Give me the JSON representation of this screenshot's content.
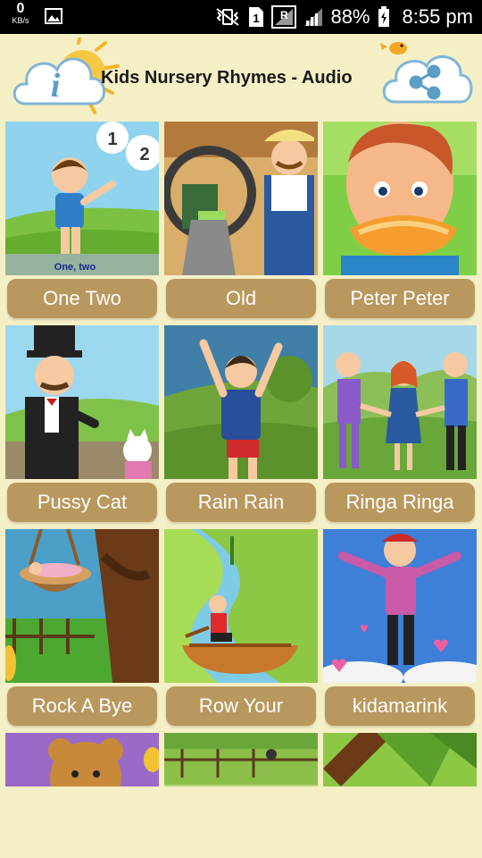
{
  "status_bar": {
    "speed_value": "0",
    "speed_unit": "KB/s",
    "battery_percent": "88%",
    "time": "8:55 pm",
    "icons": [
      "image-icon",
      "vibrate-mute-icon",
      "sim-1-icon",
      "signal-r-icon",
      "signal-icon",
      "battery-icon"
    ]
  },
  "header": {
    "title": "Kids Nursery Rhymes - Audio",
    "info_icon": "info-icon",
    "share_icon": "share-icon"
  },
  "rhymes": [
    {
      "label": "One Two",
      "caption": "One, two"
    },
    {
      "label": "Old"
    },
    {
      "label": "Peter Peter"
    },
    {
      "label": "Pussy Cat"
    },
    {
      "label": "Rain Rain"
    },
    {
      "label": "Ringa Ringa"
    },
    {
      "label": "Rock A Bye"
    },
    {
      "label": "Row Your"
    },
    {
      "label": "kidamarink"
    }
  ],
  "colors": {
    "background": "#f5efc6",
    "button": "#b9985e",
    "button_text": "#ffffff",
    "title_text": "#1a1a1a"
  }
}
